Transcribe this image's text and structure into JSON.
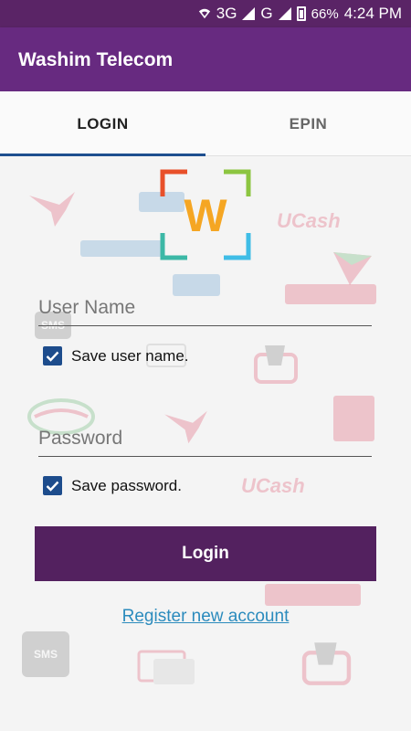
{
  "statusbar": {
    "network_3g": "3G",
    "network_g": "G",
    "battery": "66%",
    "time": "4:24 PM"
  },
  "appbar": {
    "title": "Washim Telecom"
  },
  "tabs": [
    {
      "label": "LOGIN",
      "active": true
    },
    {
      "label": "EPIN",
      "active": false
    }
  ],
  "logo": {
    "letter": "W"
  },
  "form": {
    "username_placeholder": "User Name",
    "username_value": "",
    "save_username_label": "Save user name.",
    "save_username_checked": true,
    "password_placeholder": "Password",
    "password_value": "",
    "save_password_label": "Save password.",
    "save_password_checked": true,
    "login_label": "Login",
    "register_label": "Register new account"
  },
  "background_watermarks": {
    "ucash": "UCash",
    "sms": "SMS"
  },
  "colors": {
    "statusbar": "#5a2466",
    "appbar": "#672a80",
    "tab_indicator": "#1e4f8f",
    "button": "#53215f",
    "checkbox": "#1d4c8c",
    "link": "#2b8bbd"
  }
}
